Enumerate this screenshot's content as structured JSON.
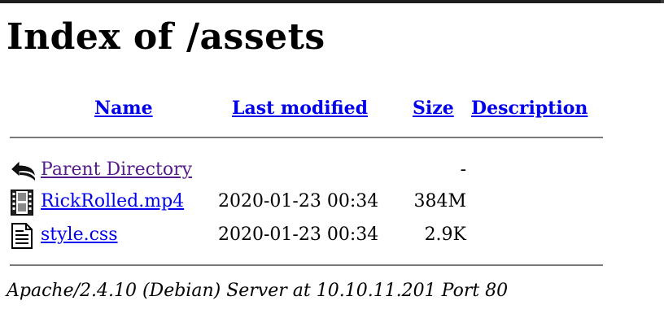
{
  "page": {
    "title": "Index of /assets"
  },
  "table": {
    "headers": {
      "name": "Name",
      "last_modified": "Last modified",
      "size": "Size",
      "description": "Description"
    },
    "rows": [
      {
        "icon": "back-arrow-icon",
        "name": "Parent Directory",
        "last_modified": "",
        "size": "-",
        "description": ""
      },
      {
        "icon": "film-icon",
        "name": "RickRolled.mp4",
        "last_modified": "2020-01-23 00:34",
        "size": "384M",
        "description": ""
      },
      {
        "icon": "text-file-icon",
        "name": "style.css",
        "last_modified": "2020-01-23 00:34",
        "size": "2.9K",
        "description": ""
      }
    ]
  },
  "footer": {
    "address": "Apache/2.4.10 (Debian) Server at 10.10.11.201 Port 80"
  },
  "colors": {
    "link": "#0000ee",
    "visited_link": "#551a8b",
    "rule": "#7a7a7a"
  }
}
